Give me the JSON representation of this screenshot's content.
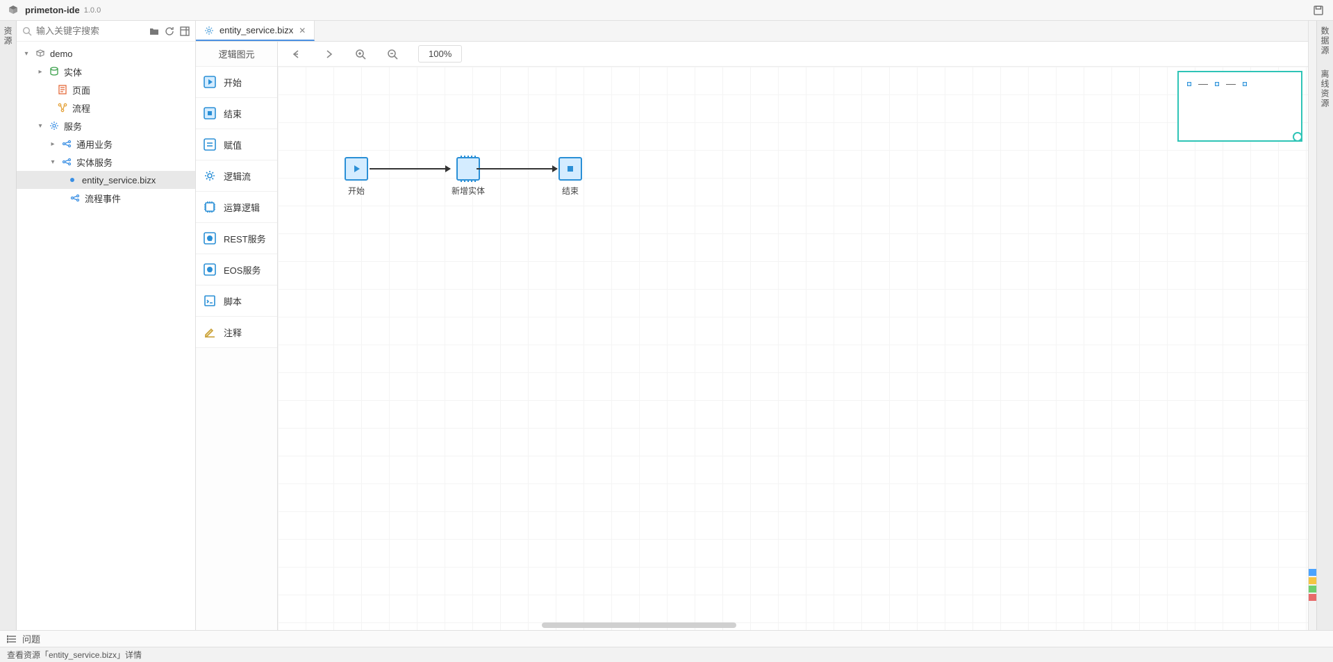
{
  "app": {
    "name": "primeton-ide",
    "version": "1.0.0"
  },
  "leftrail": {
    "label": "资源"
  },
  "rightrail": {
    "items": [
      "数据源",
      "离线资源"
    ]
  },
  "search": {
    "placeholder": "输入关键字搜索"
  },
  "tree": {
    "root": "demo",
    "n_entity": "实体",
    "n_page": "页面",
    "n_flow": "流程",
    "n_service": "服务",
    "n_common_biz": "通用业务",
    "n_entity_service": "实体服务",
    "n_file": "entity_service.bizx",
    "n_flow_event": "流程事件"
  },
  "tab": {
    "title": "entity_service.bizx"
  },
  "palette": {
    "header": "逻辑图元",
    "items": [
      "开始",
      "结束",
      "赋值",
      "逻辑流",
      "运算逻辑",
      "REST服务",
      "EOS服务",
      "脚本",
      "注释"
    ]
  },
  "toolbar": {
    "zoom": "100%"
  },
  "canvas": {
    "nodes": {
      "start": "开始",
      "mid": "新增实体",
      "end": "结束"
    }
  },
  "bottom": {
    "problems": "问题"
  },
  "status": {
    "text": "查看资源「entity_service.bizx」详情"
  }
}
